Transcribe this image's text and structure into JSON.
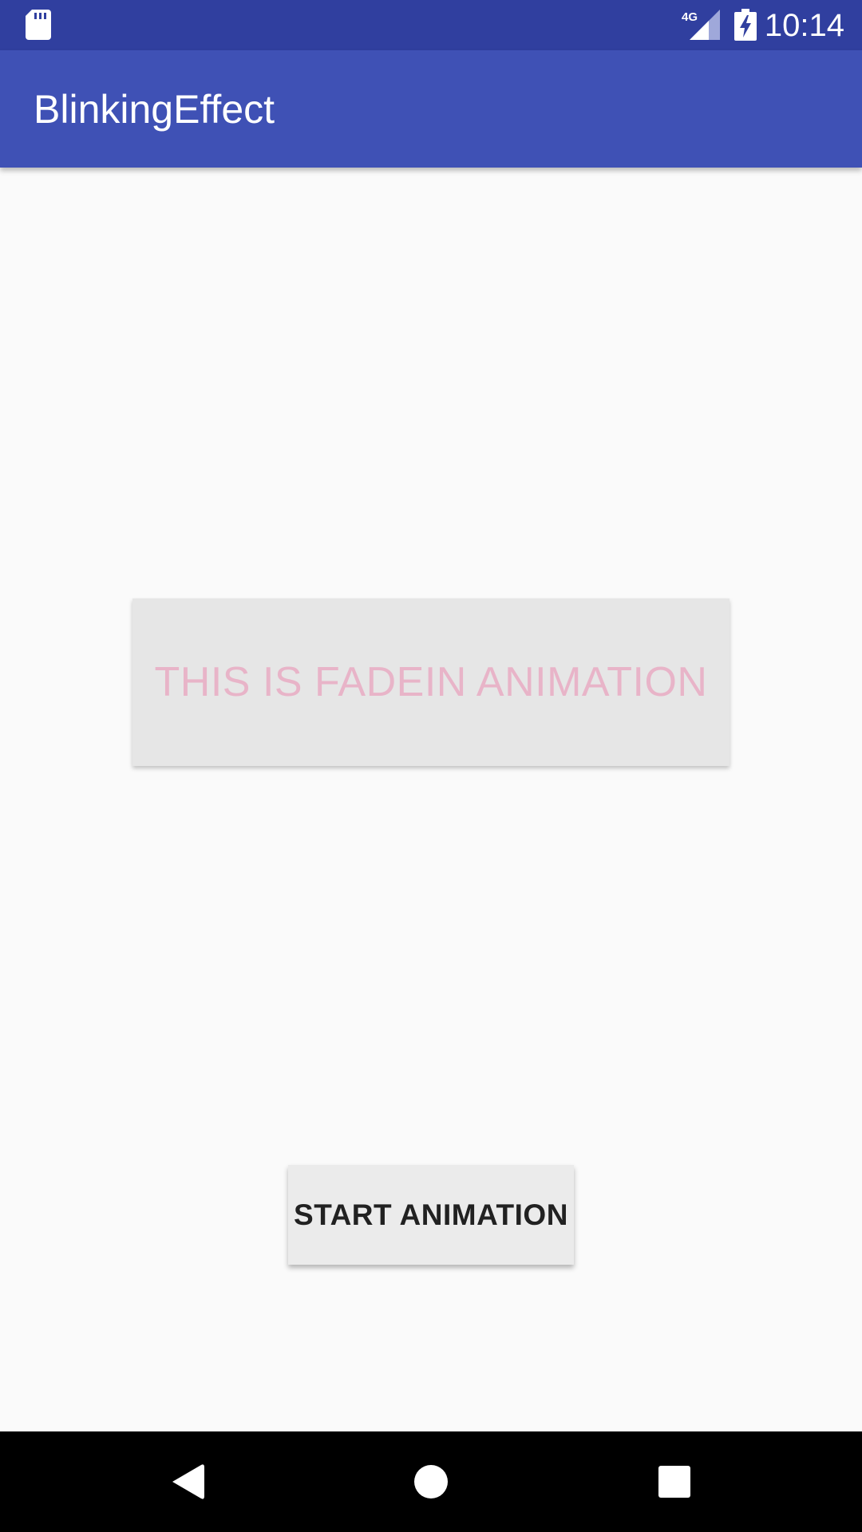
{
  "status_bar": {
    "time": "10:14",
    "network_label": "4G",
    "icons": [
      "sd-card-icon",
      "signal-4g-icon",
      "battery-charging-icon"
    ]
  },
  "app_bar": {
    "title": "BlinkingEffect"
  },
  "main": {
    "animated_text": "THIS IS FADEIN ANIMATION",
    "start_button_label": "START ANIMATION"
  },
  "nav_bar": {
    "icons": [
      "back-icon",
      "home-icon",
      "recents-icon"
    ]
  },
  "colors": {
    "status_bar": "#303f9f",
    "app_bar": "#3f51b5",
    "background": "#fafafa",
    "animated_text": "#e8b4c8",
    "nav_bar": "#000000"
  }
}
